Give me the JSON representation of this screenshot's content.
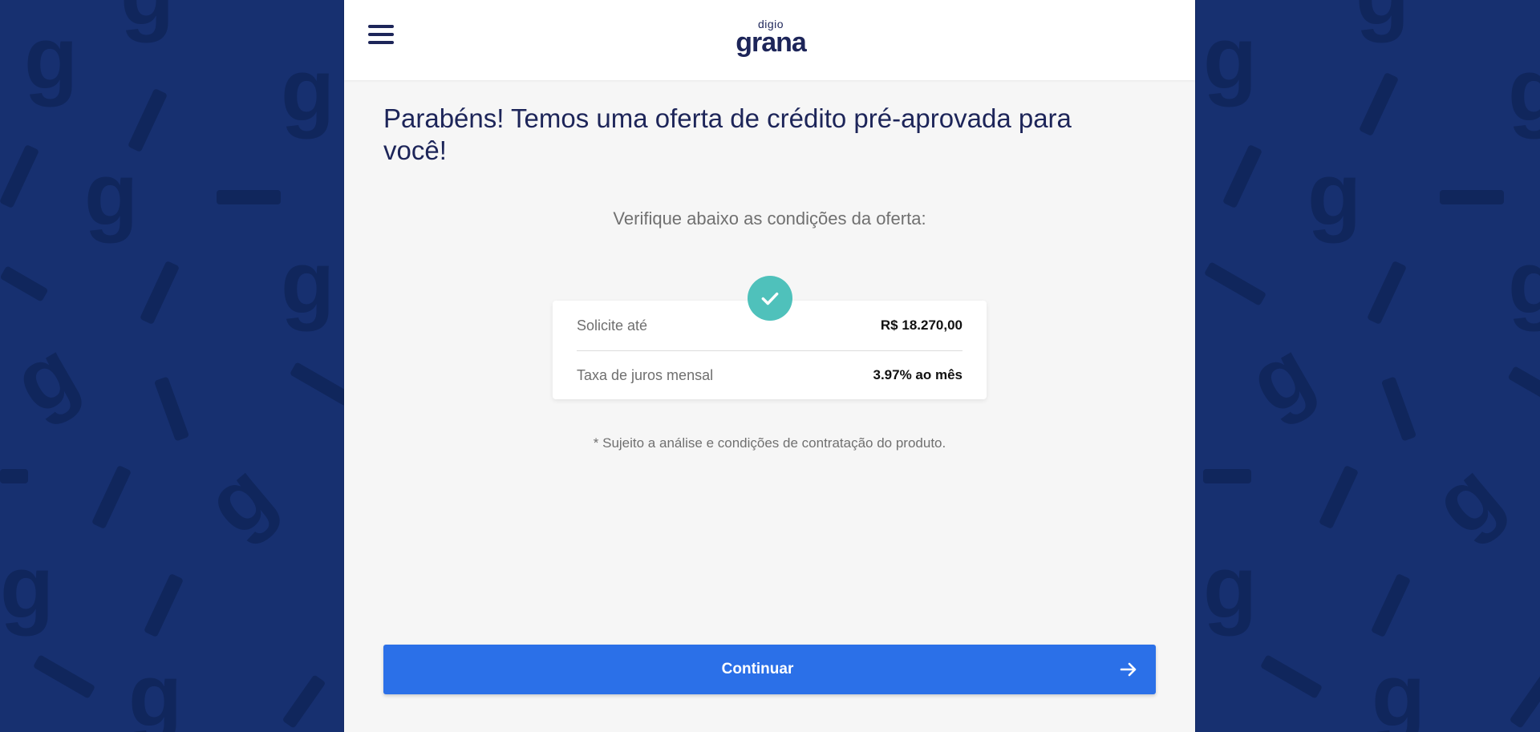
{
  "brand": {
    "logo_small": "digio",
    "logo_main": "grana",
    "primary_color": "#1d2559",
    "accent_color": "#2b70e8",
    "success_color": "#4fc1bb",
    "background_color": "#173070"
  },
  "header": {
    "menu_icon": "hamburger-menu-icon"
  },
  "main": {
    "headline": "Parabéns! Temos uma oferta de crédito pré-aprovada para você!",
    "subtitle": "Verifique abaixo as condições da oferta:",
    "offer": {
      "badge_icon": "check-icon",
      "rows": [
        {
          "label": "Solicite até",
          "value": "R$ 18.270,00"
        },
        {
          "label": "Taxa de juros mensal",
          "value": "3.97% ao mês"
        }
      ]
    },
    "disclaimer": "* Sujeito a análise e condições de contratação do produto.",
    "continue_button": {
      "label": "Continuar",
      "icon": "arrow-right-icon"
    }
  }
}
